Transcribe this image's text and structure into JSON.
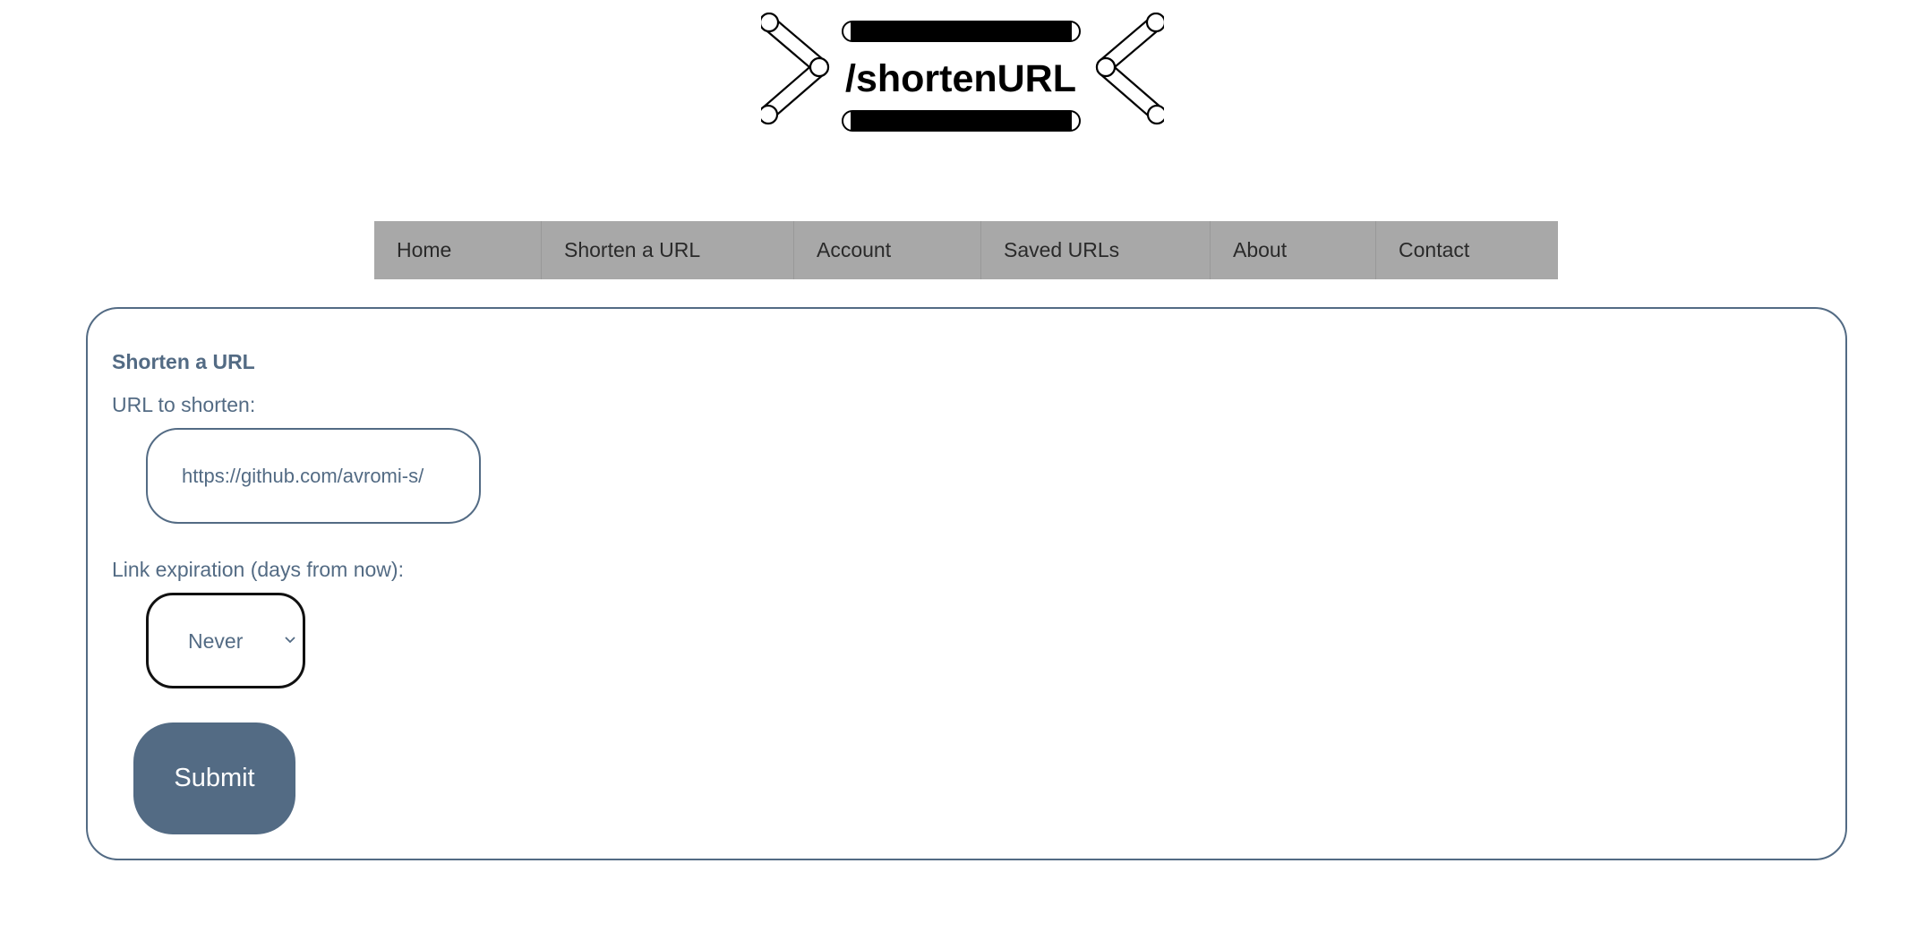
{
  "logo": {
    "text": "/shortenURL",
    "icon": "chain-link-logo"
  },
  "nav": {
    "items": [
      {
        "label": "Home"
      },
      {
        "label": "Shorten a URL"
      },
      {
        "label": "Account"
      },
      {
        "label": "Saved URLs"
      },
      {
        "label": "About"
      },
      {
        "label": "Contact"
      }
    ]
  },
  "form": {
    "title": "Shorten a URL",
    "url_label": "URL to shorten:",
    "url_value": "https://github.com/avromi-s/",
    "expiration_label": "Link expiration (days from now):",
    "expiration_selected": "Never",
    "submit_label": "Submit"
  },
  "colors": {
    "accent": "#536b84",
    "nav_bg": "#a8a8a8",
    "text_dark": "#2a2a2a"
  }
}
